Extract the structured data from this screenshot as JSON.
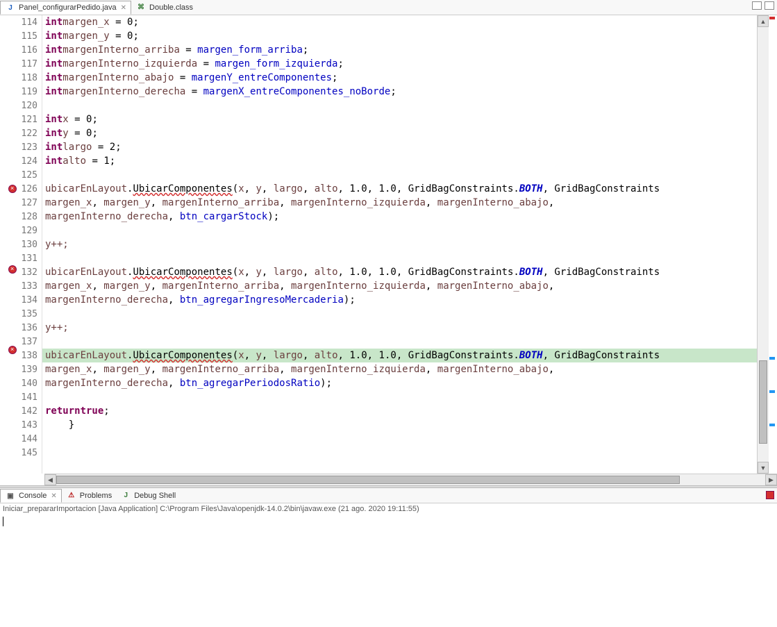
{
  "tabs": {
    "file1": "Panel_configurarPedido.java",
    "file2": "Double.class"
  },
  "gutter": [
    "114",
    "115",
    "116",
    "117",
    "118",
    "119",
    "120",
    "121",
    "122",
    "123",
    "124",
    "125",
    "126",
    "127",
    "128",
    "129",
    "130",
    "131",
    "132",
    "133",
    "134",
    "135",
    "136",
    "137",
    "138",
    "139",
    "140",
    "141",
    "142",
    "143",
    "144",
    "145"
  ],
  "bottomTabs": {
    "console": "Console",
    "problems": "Problems",
    "debug": "Debug Shell"
  },
  "consoleHeader": {
    "launch": "Iniciar_prepararImportacion [Java Application] ",
    "path": "C:\\Program Files\\Java\\openjdk-14.0.2\\bin\\javaw.exe",
    "ts": " (21 ago. 2020 19:11:55)"
  },
  "code": {
    "int": "int",
    "return": "return",
    "true": "true",
    "margen_x": "margen_x",
    "margen_y": "margen_y",
    "margenInterno_arriba": "margenInterno_arriba",
    "margenInterno_izquierda": "margenInterno_izquierda",
    "margenInterno_abajo": "margenInterno_abajo",
    "margenInterno_derecha": "margenInterno_derecha",
    "margen_form_arriba": "margen_form_arriba",
    "margen_form_izquierda": "margen_form_izquierda",
    "margenY_entreComponentes": "margenY_entreComponentes",
    "margenX_entreComponentes_noBorde": "margenX_entreComponentes_noBorde",
    "x": "x",
    "y": "y",
    "largo": "largo",
    "alto": "alto",
    "zero": "0",
    "one": "1",
    "two": "2",
    "oned": "1.0",
    "ypp": "y++;",
    "ubicarEnLayout": "ubicarEnLayout",
    "UbicarComponentes": "UbicarComponentes",
    "GridBagConstraints": "GridBagConstraints",
    "BOTH": "BOTH",
    "btn_cargarStock": "btn_cargarStock",
    "btn_agregarIngresoMercaderia": "btn_agregarIngresoMercaderia",
    "btn_agregarPeriodosRatio": "btn_agregarPeriodosRatio"
  }
}
